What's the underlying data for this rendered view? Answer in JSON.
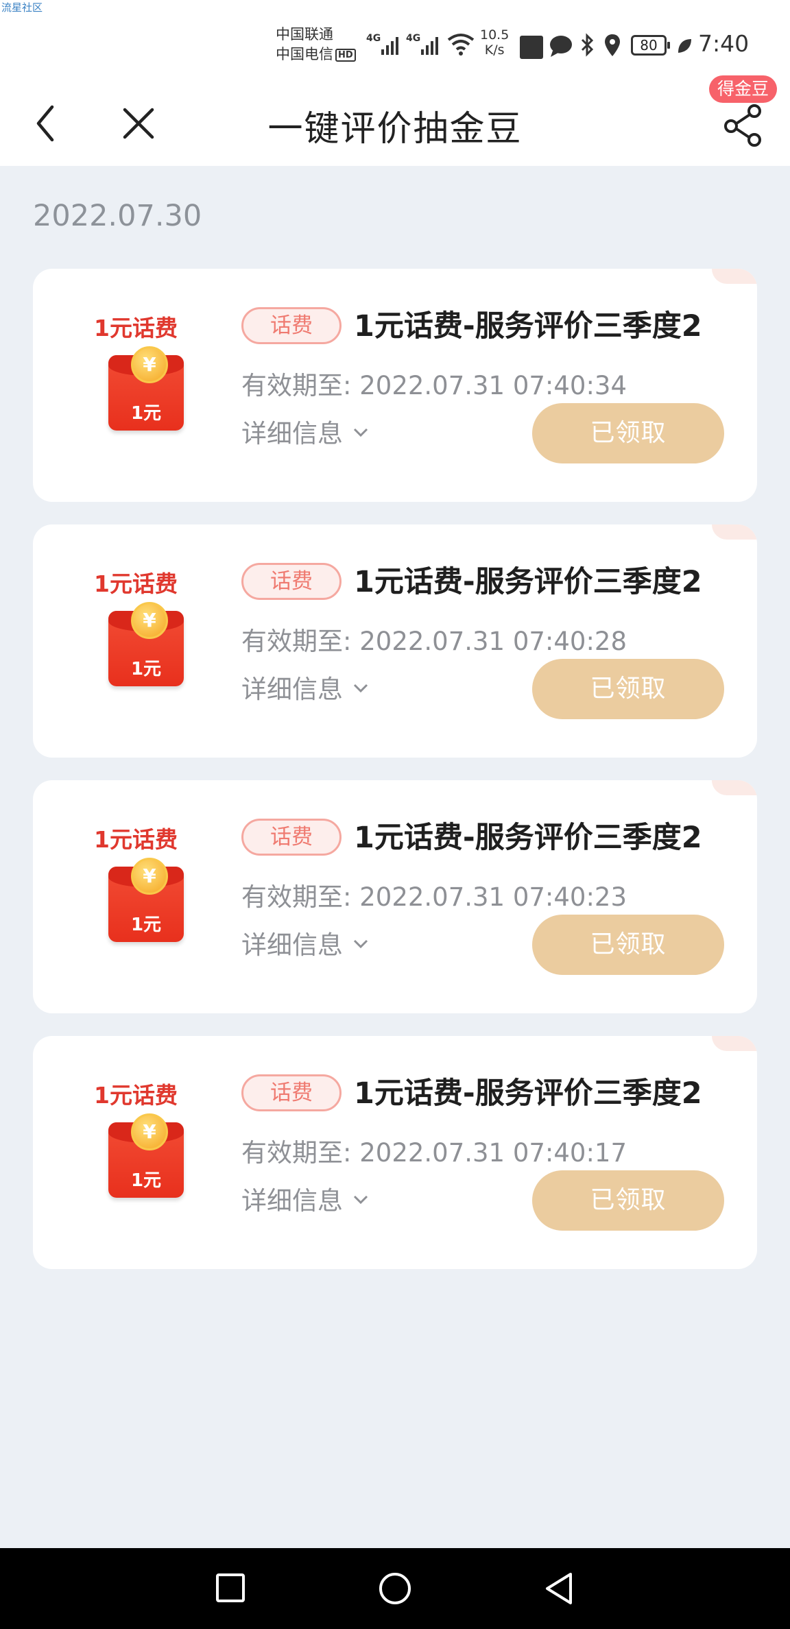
{
  "status_bar": {
    "watermark": "流星社区",
    "carrier_1": "中国联通",
    "carrier_2": "中国电信",
    "hd_badge": "HD",
    "network_1": "4G",
    "network_2": "4G",
    "net_speed_value": "10.5",
    "net_speed_unit": "K/s",
    "battery": "80",
    "time": "7:40"
  },
  "nav": {
    "title": "一键评价抽金豆",
    "badge": "得金豆"
  },
  "date_heading": "2022.07.30",
  "prizes": [
    {
      "image_caption": "1元话费",
      "envelope_amount": "1元",
      "tag": "话费",
      "title": "1元话费-服务评价三季度2",
      "expiry_label": "有效期至:",
      "expiry_value": "2022.07.31 07:40:34",
      "details_label": "详细信息",
      "button_label": "已领取"
    },
    {
      "image_caption": "1元话费",
      "envelope_amount": "1元",
      "tag": "话费",
      "title": "1元话费-服务评价三季度2",
      "expiry_label": "有效期至:",
      "expiry_value": "2022.07.31 07:40:28",
      "details_label": "详细信息",
      "button_label": "已领取"
    },
    {
      "image_caption": "1元话费",
      "envelope_amount": "1元",
      "tag": "话费",
      "title": "1元话费-服务评价三季度2",
      "expiry_label": "有效期至:",
      "expiry_value": "2022.07.31 07:40:23",
      "details_label": "详细信息",
      "button_label": "已领取"
    },
    {
      "image_caption": "1元话费",
      "envelope_amount": "1元",
      "tag": "话费",
      "title": "1元话费-服务评价三季度2",
      "expiry_label": "有效期至:",
      "expiry_value": "2022.07.31 07:40:17",
      "details_label": "详细信息",
      "button_label": "已领取"
    }
  ],
  "colors": {
    "page_background": "#ecf0f5",
    "claimed_button": "#ebcc9f",
    "tag_text": "#ef7a70",
    "badge": "#f7626a"
  }
}
